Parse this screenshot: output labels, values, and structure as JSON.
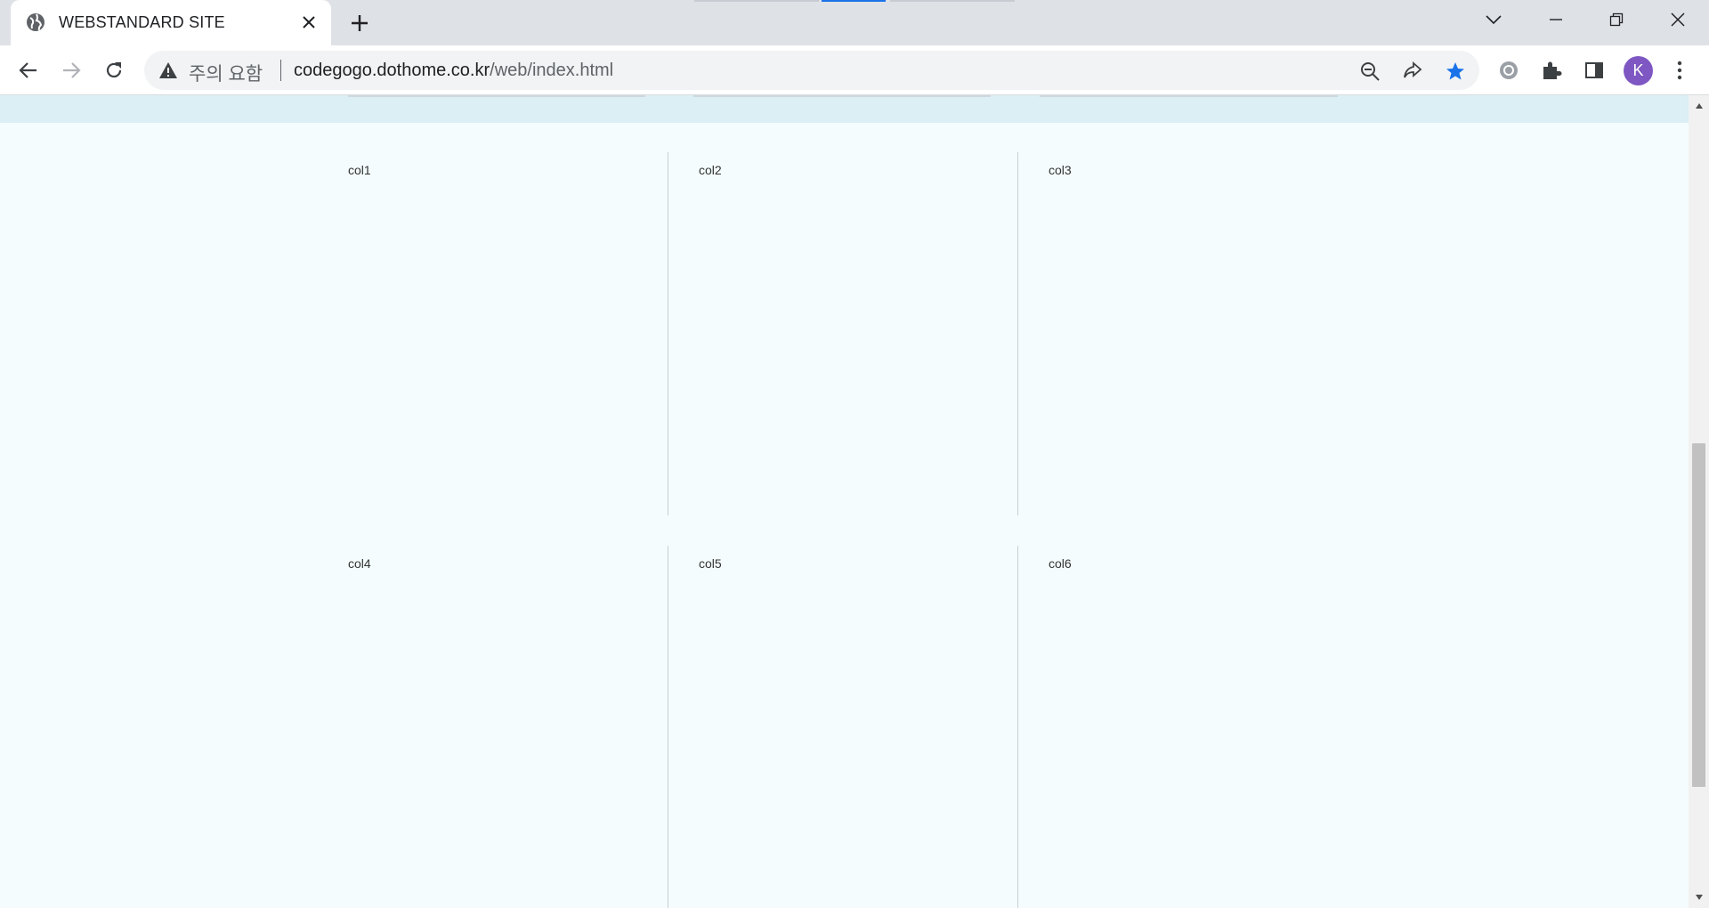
{
  "browser": {
    "tab": {
      "title": "WEBSTANDARD SITE"
    },
    "omnibox": {
      "security_status": "주의 요함",
      "url_domain": "codegogo.dothome.co.kr",
      "url_path": "/web/index.html"
    },
    "profile_initial": "K",
    "icons": {
      "favicon": "globe-icon",
      "tab_close": "close-icon",
      "new_tab": "plus-icon",
      "tab_search": "chevron-down-icon",
      "minimize": "minimize-icon",
      "restore": "restore-icon",
      "close_window": "close-icon",
      "back": "arrow-left-icon",
      "forward": "arrow-right-icon",
      "reload": "reload-icon",
      "not_secure": "warning-icon",
      "zoom": "zoom-out-icon",
      "share": "share-icon",
      "bookmark": "star-icon",
      "extension_settings": "gear-icon",
      "extensions": "puzzle-icon",
      "side_panel": "side-panel-icon",
      "menu": "kebab-menu-icon"
    },
    "colors": {
      "tabstrip": "#dee1e6",
      "accent": "#1a73e8",
      "avatar": "#7e57c2"
    }
  },
  "page": {
    "columns": [
      {
        "label": "col1"
      },
      {
        "label": "col2"
      },
      {
        "label": "col3"
      },
      {
        "label": "col4"
      },
      {
        "label": "col5"
      },
      {
        "label": "col6"
      }
    ],
    "colors": {
      "background": "#f4fcfd",
      "top_band": "#dbeff5",
      "divider": "#c9cfd2"
    }
  }
}
